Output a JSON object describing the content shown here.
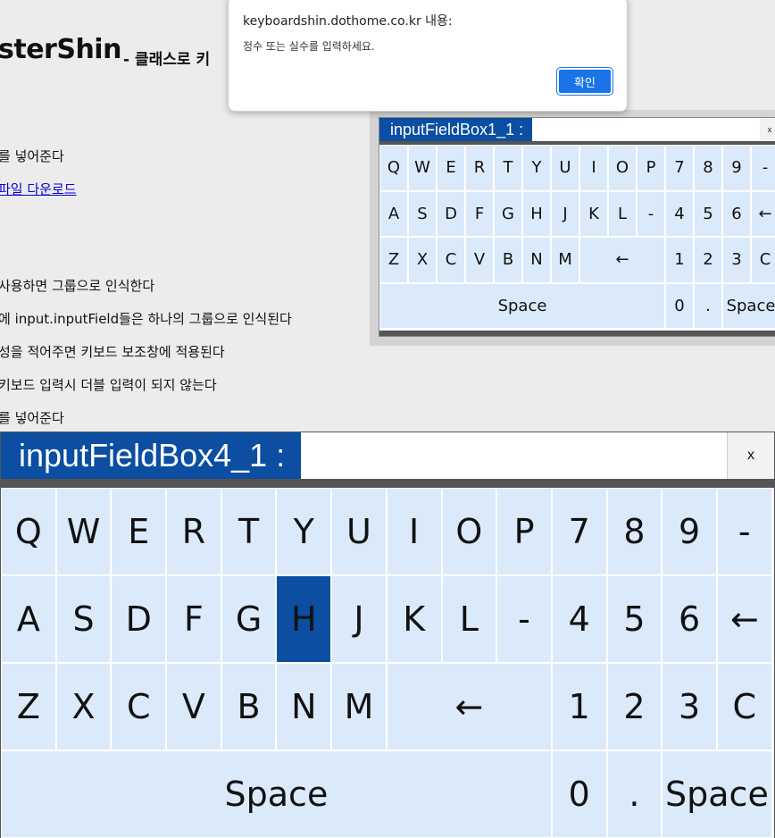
{
  "page": {
    "title": "sterShin",
    "subtitle": "- 클래스로 키",
    "lines": [
      "를 넣어준다",
      "파일 다운로드",
      "사용하면 그룹으로 인식한다",
      "에 input.inputField들은 하나의 그룹으로 인식된다",
      "성을 적어주면 키보드 보조창에 적용된다",
      " 키보드 입력시 더블 입력이 되지 않는다",
      "를 넣어준다"
    ]
  },
  "alert": {
    "title": "keyboardshin.dothome.co.kr 내용:",
    "message": "정수 또는 실수를 입력하세요.",
    "ok_label": "확인"
  },
  "keyboard_small": {
    "label": "inputFieldBox1_1 :",
    "value": "",
    "close_label": "x"
  },
  "keyboard_large": {
    "label": "inputFieldBox4_1 :",
    "value": "",
    "close_label": "x",
    "pressed_key": "H"
  },
  "keys": {
    "row1": [
      "Q",
      "W",
      "E",
      "R",
      "T",
      "Y",
      "U",
      "I",
      "O",
      "P",
      "7",
      "8",
      "9",
      "-"
    ],
    "row2": [
      "A",
      "S",
      "D",
      "F",
      "G",
      "H",
      "J",
      "K",
      "L",
      "-",
      "4",
      "5",
      "6",
      "←"
    ],
    "row3_letters": [
      "Z",
      "X",
      "C",
      "V",
      "B",
      "N",
      "M"
    ],
    "row3_backspace": "←",
    "row3_digits": [
      "1",
      "2",
      "3",
      "C"
    ],
    "space_left": "Space",
    "zero": "0",
    "dot": ".",
    "space_right": "Space"
  },
  "colors": {
    "key_bg": "#dbeafb",
    "label_bg": "#0b4ea2",
    "accent_button": "#1a73e8"
  }
}
